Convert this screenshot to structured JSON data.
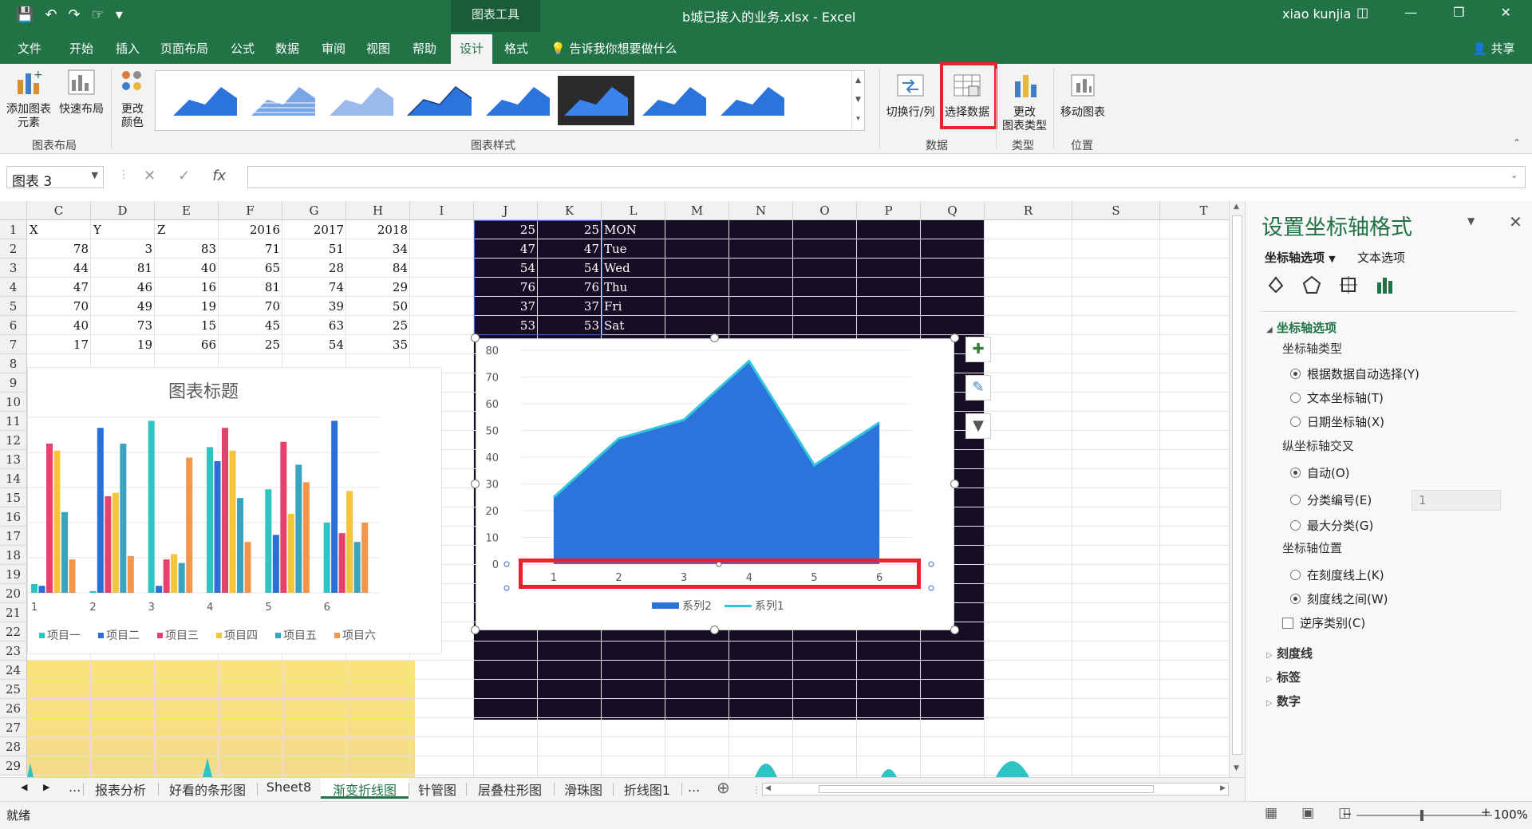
{
  "titlebar": {
    "context_tab": "图表工具",
    "doc_title": "b城已接入的业务.xlsx  -  Excel",
    "user": "xiao kunjia"
  },
  "tabs": [
    "文件",
    "开始",
    "插入",
    "页面布局",
    "公式",
    "数据",
    "审阅",
    "视图",
    "帮助",
    "设计",
    "格式"
  ],
  "active_tab": "设计",
  "tell_me": "告诉我你想要做什么",
  "share": "共享",
  "ribbon": {
    "add_element": [
      "添加图表",
      "元素"
    ],
    "quick_layout": "快速布局",
    "change_color": [
      "更改",
      "颜色"
    ],
    "group_layout": "图表布局",
    "group_styles": "图表样式",
    "switch_row_col": "切换行/列",
    "select_data": "选择数据",
    "change_type": [
      "更改",
      "图表类型"
    ],
    "move_chart": "移动图表",
    "group_data": "数据",
    "group_type": "类型",
    "group_location": "位置"
  },
  "name_box": "图表 3",
  "columns": [
    "C",
    "D",
    "E",
    "F",
    "G",
    "H",
    "I",
    "J",
    "K",
    "L",
    "M",
    "N",
    "O",
    "P",
    "Q",
    "R",
    "S",
    "T"
  ],
  "rows": [
    1,
    2,
    3,
    4,
    5,
    6,
    7,
    8,
    9,
    10,
    11,
    12,
    13,
    14,
    15,
    16,
    17,
    18,
    19,
    20,
    21,
    22,
    23,
    24,
    25,
    26,
    27,
    28,
    29
  ],
  "table_left": {
    "headers": [
      "X",
      "Y",
      "Z",
      "2016",
      "2017",
      "2018"
    ],
    "rows": [
      [
        78,
        3,
        83,
        71,
        51,
        34
      ],
      [
        44,
        81,
        40,
        65,
        28,
        84
      ],
      [
        47,
        46,
        16,
        81,
        74,
        29
      ],
      [
        70,
        49,
        19,
        70,
        39,
        50
      ],
      [
        40,
        73,
        15,
        45,
        63,
        25
      ],
      [
        17,
        19,
        66,
        25,
        54,
        35
      ]
    ]
  },
  "table_right": {
    "rows": [
      [
        25,
        25,
        "MON"
      ],
      [
        47,
        47,
        "Tue"
      ],
      [
        54,
        54,
        "Wed"
      ],
      [
        76,
        76,
        "Thu"
      ],
      [
        37,
        37,
        "Fri"
      ],
      [
        53,
        53,
        "Sat"
      ]
    ]
  },
  "chart_data": [
    {
      "type": "bar",
      "title": "图表标题",
      "categories": [
        "1",
        "2",
        "3",
        "4",
        "5",
        "6"
      ],
      "series": [
        {
          "name": "项目一",
          "color": "#2ec4c4",
          "values": [
            5,
            1,
            98,
            83,
            59,
            40
          ]
        },
        {
          "name": "项目二",
          "color": "#2a6fd6",
          "values": [
            4,
            94,
            4,
            75,
            33,
            98
          ]
        },
        {
          "name": "项目三",
          "color": "#e8416b",
          "values": [
            85,
            55,
            19,
            94,
            86,
            34
          ]
        },
        {
          "name": "项目四",
          "color": "#f7c53a",
          "values": [
            81,
            57,
            22,
            81,
            45,
            58
          ]
        },
        {
          "name": "项目五",
          "color": "#3aa3bd",
          "values": [
            46,
            85,
            17,
            54,
            73,
            29
          ]
        },
        {
          "name": "项目六",
          "color": "#f5954a",
          "values": [
            19,
            21,
            77,
            29,
            63,
            40
          ]
        }
      ],
      "ylim": [
        0,
        100
      ],
      "legend": "bottom"
    },
    {
      "type": "area",
      "categories": [
        "1",
        "2",
        "3",
        "4",
        "5",
        "6"
      ],
      "series": [
        {
          "name": "系列2",
          "kind": "area",
          "color": "#2c73db",
          "values": [
            25,
            47,
            54,
            76,
            37,
            53
          ]
        },
        {
          "name": "系列1",
          "kind": "line",
          "color": "#33c7dd",
          "values": [
            25,
            47,
            54,
            76,
            37,
            53
          ]
        }
      ],
      "yticks": [
        0,
        10,
        20,
        30,
        40,
        50,
        60,
        70,
        80
      ],
      "ylim": [
        0,
        80
      ],
      "legend": "bottom"
    }
  ],
  "sheet_tabs": [
    "...",
    "报表分析",
    "好看的条形图",
    "Sheet8",
    "渐变折线图",
    "针管图",
    "层叠柱形图",
    "滑珠图",
    "折线图1",
    "..."
  ],
  "active_sheet": "渐变折线图",
  "pane": {
    "title": "设置坐标轴格式",
    "tab_axis": "坐标轴选项",
    "tab_text": "文本选项",
    "section_axis_options": "坐标轴选项",
    "axis_type_label": "坐标轴类型",
    "axis_type_options": [
      "根据数据自动选择(Y)",
      "文本坐标轴(T)",
      "日期坐标轴(X)"
    ],
    "vcross_label": "纵坐标轴交叉",
    "vcross_options": [
      "自动(O)",
      "分类编号(E)",
      "最大分类(G)"
    ],
    "vcross_value": "1",
    "axis_pos_label": "坐标轴位置",
    "axis_pos_options": [
      "在刻度线上(K)",
      "刻度线之间(W)"
    ],
    "reverse_label": "逆序类别(C)",
    "collapsed": [
      "刻度线",
      "标签",
      "数字"
    ]
  },
  "status": {
    "ready": "就绪",
    "zoom": "100%"
  }
}
